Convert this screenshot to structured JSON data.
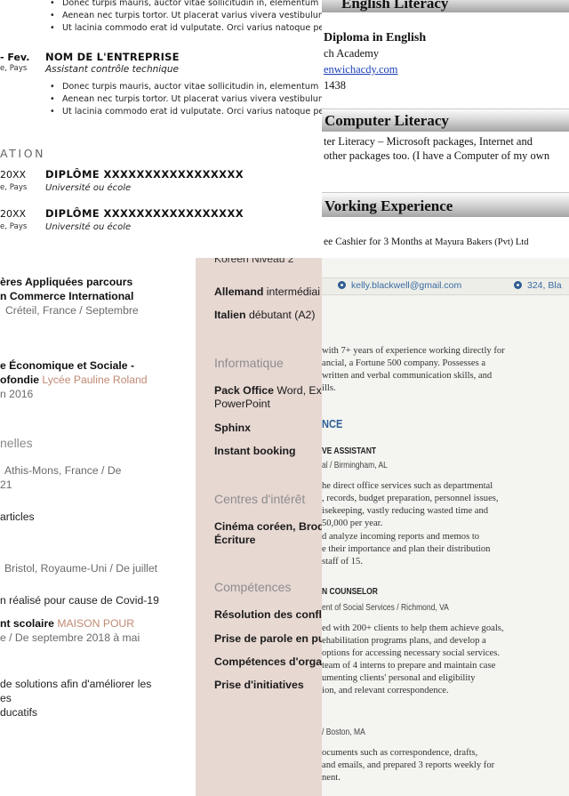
{
  "french_cv": {
    "top_bullets": [
      "Donec turpis mauris, auctor vitae sollicitudin in, elementum et",
      "Aenean nec turpis tortor. Ut placerat varius vivera vestibulum",
      "Ut lacinia commodo erat id vulputate. Orci varius natoque pen"
    ],
    "job": {
      "date": "- Fev.",
      "location": "e, Pays",
      "company": "NOM DE L'ENTREPRISE",
      "role": "Assistant contrôle technique",
      "bullets": [
        "Donec turpis mauris, auctor vitae sollicitudin in, elementum et",
        "Aenean nec turpis tortor. Ut placerat varius vivera vestibulum",
        "Ut lacinia commodo erat id vulputate. Orci varius natoque pen"
      ]
    },
    "section_title": "ATION",
    "education": [
      {
        "date": "20XX",
        "location": "e, Pays",
        "diploma": "DIPLÔME XXXXXXXXXXXXXXXXX",
        "school": "Université ou école"
      },
      {
        "date": "20XX",
        "location": "e, Pays",
        "diploma": "DIPLÔME XXXXXXXXXXXXXXXXX",
        "school": "Université ou école"
      }
    ]
  },
  "english_cv": {
    "english_title": "English Literacy",
    "diploma": "Diploma in English",
    "academy": "ch Academy",
    "website": "enwichacdy.com",
    "number": "1438",
    "computer_title": "Computer Literacy",
    "computer_line1": "ter Literacy – Microsoft packages, Internet and",
    "computer_line2": "other packages too. (I have a Computer of my own",
    "work_title": "Vorking Experience",
    "work_line_main": "ee Cashier  for 3 Months at",
    "work_line_small": "Mayura Bakers (Pvt) Ltd"
  },
  "italic_cv": {
    "lines": [
      "ères Appliquées parcours",
      "n Commerce International",
      "Créteil, France / Septembre",
      "e Économique et Sociale -",
      "ofondie",
      "Lycée Pauline Roland",
      "n 2016",
      "nelles",
      "Athis-Mons, France / De",
      "21",
      "articles",
      "Bristol, Royaume-Uni / De juillet",
      "n réalisé pour cause de Covid-19",
      "nt scolaire",
      "MAISON POUR",
      "e / De septembre 2018 à mai",
      "de solutions afin d'améliorer les",
      "es",
      "ducatifs"
    ]
  },
  "sidebar": {
    "cut_line": "Koreen Niveau 2",
    "languages": [
      {
        "name": "Allemand",
        "level": "intermédiai"
      },
      {
        "name": "Italien",
        "level": "débutant (A2)"
      }
    ],
    "informatique_title": "Informatique",
    "informatique_items": [
      {
        "name": "Pack Office",
        "detail": "Word, Ex"
      },
      {
        "name": "",
        "detail": "PowerPoint"
      },
      {
        "name": "Sphinx",
        "detail": ""
      },
      {
        "name": "Instant booking",
        "detail": ""
      }
    ],
    "interests_title": "Centres d'intérêt",
    "interests": [
      "Cinéma coréen, Brod",
      "Écriture"
    ],
    "skills_title": "Compétences",
    "skills": [
      "Résolution des conflit",
      "Prise de parole en pu",
      "Compétences d'organ",
      "Prise d'initiatives"
    ]
  },
  "scan_cv": {
    "contact_email": "kelly.blackwell@gmail.com",
    "contact_address": "324, Bla",
    "summary": [
      "with 7+ years of experience working directly for",
      "ancial, a Fortune 500 company. Possesses a",
      "written and verbal communication skills, and",
      "ills."
    ],
    "section": "NCE",
    "job1_title": "VE ASSISTANT",
    "job1_sub": "al / Birmingham, AL",
    "job1_lines": [
      "he direct office services such as departmental",
      ", records, budget preparation, personnel issues,",
      "isekeeping, vastly reducing wasted time and",
      "50,000 per year.",
      "d analyze incoming reports and memos to",
      "e their importance and plan their distribution",
      "staff of 15."
    ],
    "job2_title": "N COUNSELOR",
    "job2_sub": "ent of Social Services / Richmond, VA",
    "job2_lines": [
      "ed with 200+ clients to help them achieve goals,",
      "ehabilitation programs plans, and develop a",
      "options for accessing necessary social services.",
      "team of 4 interns to prepare and maintain case",
      "umenting clients' personal and eligibility",
      "ion, and relevant correspondence."
    ],
    "job3_sub": "/ Boston, MA",
    "job3_lines": [
      "ocuments such as correspondence, drafts,",
      "and emails, and prepared 3 reports weekly for",
      "nent."
    ]
  }
}
